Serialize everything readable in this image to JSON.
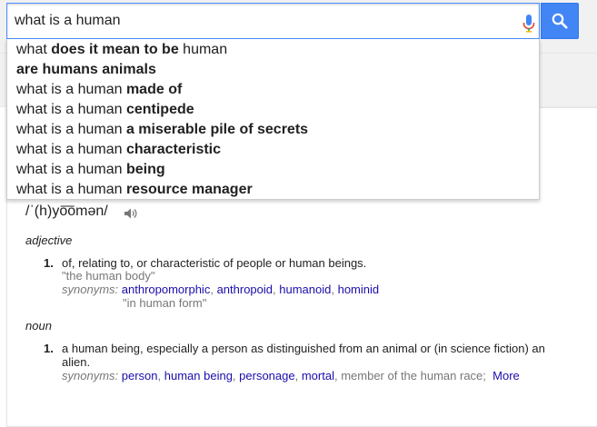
{
  "search": {
    "query": "what is a human"
  },
  "suggestions": [
    {
      "plain": "what ",
      "bold": "does it mean to be",
      "tail": " human"
    },
    {
      "plain": "",
      "bold": "are humans animals",
      "tail": ""
    },
    {
      "plain": "what is a human ",
      "bold": "made of",
      "tail": ""
    },
    {
      "plain": "what is a human ",
      "bold": "centipede",
      "tail": ""
    },
    {
      "plain": "what is a human ",
      "bold": "a miserable pile of secrets",
      "tail": ""
    },
    {
      "plain": "what is a human ",
      "bold": "characteristic",
      "tail": ""
    },
    {
      "plain": "what is a human ",
      "bold": "being",
      "tail": ""
    },
    {
      "plain": "what is a human ",
      "bold": "resource manager",
      "tail": ""
    }
  ],
  "dictionary": {
    "pronunciation": "/ˈ(h)yo͞omən/",
    "adjective": {
      "label": "adjective",
      "number": "1.",
      "definition": "of, relating to, or characteristic of people or human beings.",
      "example": "\"the human body\"",
      "synonyms_label": "synonyms:",
      "synonyms": [
        "anthropomorphic",
        "anthropoid",
        "humanoid",
        "hominid"
      ],
      "synonym_example": "\"in human form\""
    },
    "noun": {
      "label": "noun",
      "number": "1.",
      "definition_line1": "a human being, especially a person as distinguished from an animal or (in science fiction) an",
      "definition_line2": "alien.",
      "synonyms_label": "synonyms:",
      "synonyms": [
        "person",
        "human being",
        "personage",
        "mortal"
      ],
      "synonym_plain": "member of the human race;",
      "more": "More"
    }
  },
  "colors": {
    "accent": "#4285f4",
    "link": "#1a0dab",
    "muted": "#777777"
  }
}
